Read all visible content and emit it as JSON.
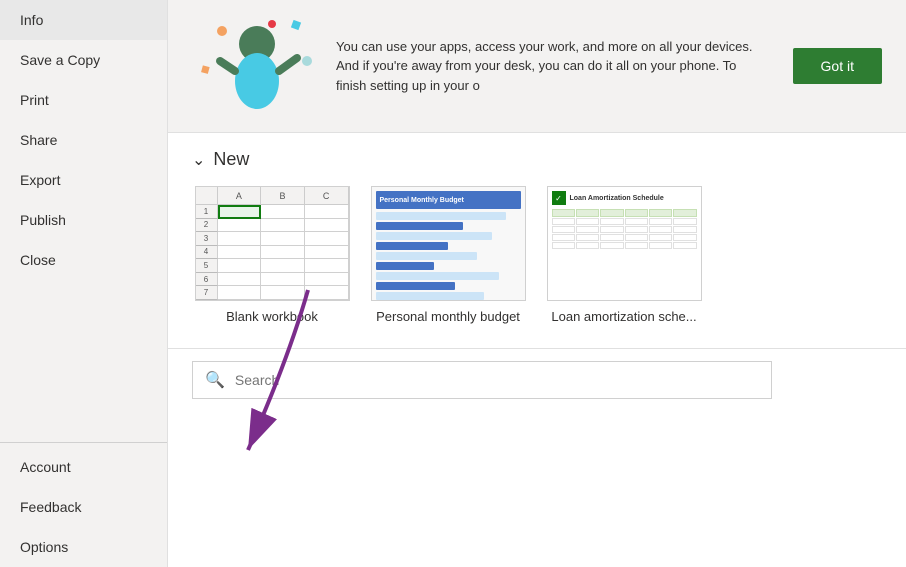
{
  "sidebar": {
    "items": [
      {
        "id": "info",
        "label": "Info",
        "active": false
      },
      {
        "id": "save-copy",
        "label": "Save a Copy",
        "active": false
      },
      {
        "id": "print",
        "label": "Print",
        "active": false
      },
      {
        "id": "share",
        "label": "Share",
        "active": false
      },
      {
        "id": "export",
        "label": "Export",
        "active": false
      },
      {
        "id": "publish",
        "label": "Publish",
        "active": false
      },
      {
        "id": "close",
        "label": "Close",
        "active": false
      }
    ],
    "bottom_items": [
      {
        "id": "account",
        "label": "Account",
        "active": false
      },
      {
        "id": "feedback",
        "label": "Feedback",
        "active": false
      },
      {
        "id": "options",
        "label": "Options",
        "active": false
      }
    ]
  },
  "banner": {
    "text": "You can use your apps, access your work, and more on all your devices. And if you're away from your desk, you can do it all on your phone. To finish setting up in your o",
    "cta_label": "Got it"
  },
  "new_section": {
    "chevron": "❮",
    "title": "New",
    "templates": [
      {
        "id": "blank",
        "label": "Blank workbook"
      },
      {
        "id": "budget",
        "label": "Personal monthly budget"
      },
      {
        "id": "loan",
        "label": "Loan amortization sche..."
      }
    ]
  },
  "search": {
    "placeholder": "Search",
    "icon": "🔍"
  }
}
